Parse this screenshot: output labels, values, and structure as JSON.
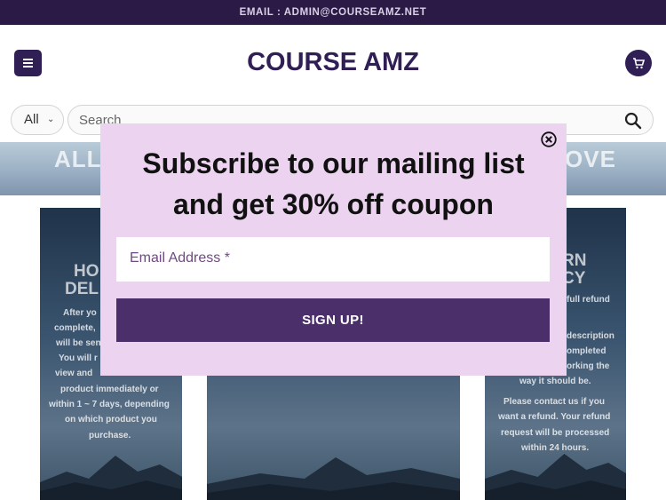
{
  "topbar": {
    "text": "EMAIL : ADMIN@COURSEAMZ.NET"
  },
  "header": {
    "title": "COURSE AMZ"
  },
  "search": {
    "category": "All",
    "placeholder": "Search"
  },
  "banner": {
    "left_text": "ALL",
    "right_text": "OVE"
  },
  "cards": {
    "left": {
      "heading_lines": [
        "HO",
        "DEL"
      ],
      "text_lines": [
        "After yo",
        "complete,",
        "will be sen",
        "You will r",
        "view and",
        "product immediately or",
        "within 1 ~ 7 days, depending",
        "on which product you",
        "purchase."
      ]
    },
    "right": {
      "heading_lines": [
        "RN",
        "CY"
      ],
      "text_lines": [
        "full refund",
        "description",
        "ompleted",
        "orking the",
        "way it should be.",
        "Please contact us if you",
        "want a refund. Your refund",
        "request will be processed",
        "within 24 hours."
      ]
    }
  },
  "popup": {
    "title_line1": "Subscribe to our mailing list",
    "title_line2": "and get 30% off coupon",
    "email_placeholder": "Email Address *",
    "signup_label": "SIGN UP!"
  },
  "colors": {
    "brand": "#2f1f55",
    "topbar": "#2a1a45",
    "popup_bg": "#ecd3f0",
    "button": "#4a2f6a"
  },
  "icons": {
    "menu": "hamburger-icon",
    "cart": "cart-icon",
    "search": "search-icon",
    "close": "close-circle-icon",
    "chevron": "chevron-down-icon"
  }
}
